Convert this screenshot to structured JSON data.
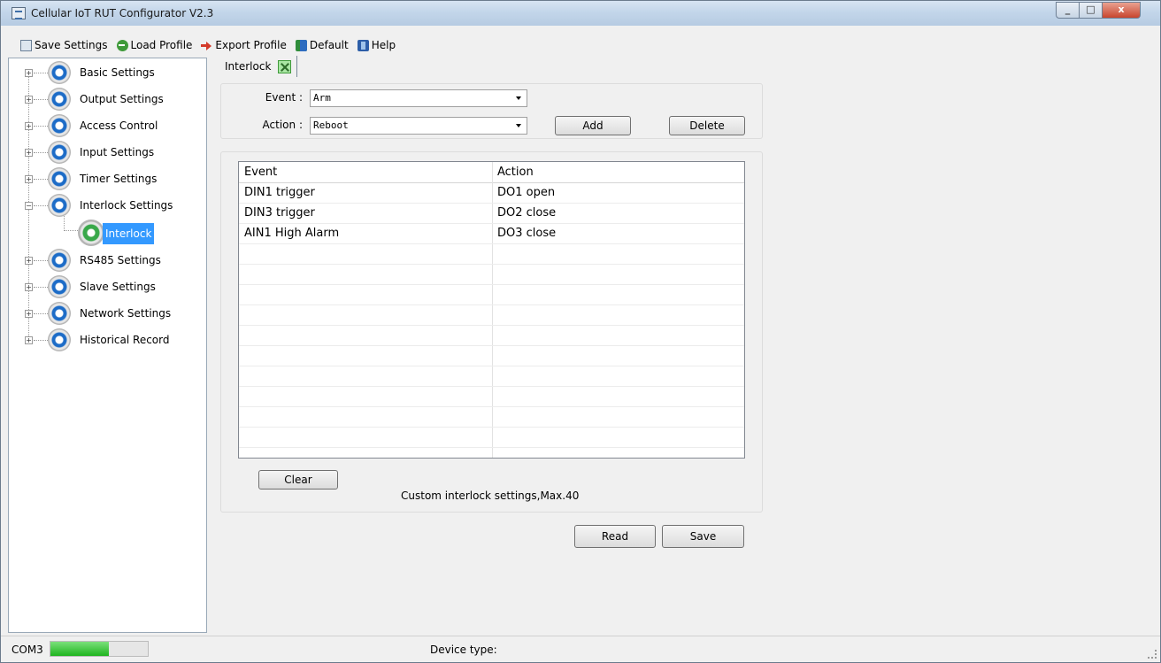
{
  "window": {
    "title": "Cellular IoT RUT Configurator V2.3"
  },
  "toolbar": {
    "items": [
      {
        "label": "Save Settings",
        "icon": "save-icon"
      },
      {
        "label": "Load Profile",
        "icon": "load-icon"
      },
      {
        "label": "Export Profile",
        "icon": "export-icon"
      },
      {
        "label": "Default",
        "icon": "default-icon"
      },
      {
        "label": "Help",
        "icon": "help-icon"
      }
    ]
  },
  "sidebar": {
    "items": [
      {
        "label": "Basic Settings"
      },
      {
        "label": "Output Settings"
      },
      {
        "label": "Access Control"
      },
      {
        "label": "Input Settings"
      },
      {
        "label": "Timer Settings"
      },
      {
        "label": "Interlock Settings",
        "expanded": true,
        "children": [
          {
            "label": "Interlock",
            "selected": true
          }
        ]
      },
      {
        "label": "RS485 Settings"
      },
      {
        "label": "Slave Settings"
      },
      {
        "label": "Network Settings"
      },
      {
        "label": "Historical Record"
      }
    ]
  },
  "tab": {
    "label": "Interlock"
  },
  "form": {
    "event_label": "Event :",
    "event_value": "Arm",
    "action_label": "Action :",
    "action_value": "Reboot",
    "add_label": "Add",
    "delete_label": "Delete"
  },
  "table": {
    "columns": [
      "Event",
      "Action"
    ],
    "rows": [
      [
        "DIN1 trigger",
        "DO1 open"
      ],
      [
        "DIN3 trigger",
        "DO2 close"
      ],
      [
        "AIN1 High Alarm",
        "DO3 close"
      ]
    ]
  },
  "clear_label": "Clear",
  "note": "Custom interlock settings,Max.40",
  "read_label": "Read",
  "save_label": "Save",
  "status": {
    "port": "COM3",
    "progress": 0.6,
    "device_type": "Device type:"
  },
  "colors": {
    "selection": "#3399ff",
    "progress": "#1fb41f",
    "accent": "#1d6cc7"
  }
}
